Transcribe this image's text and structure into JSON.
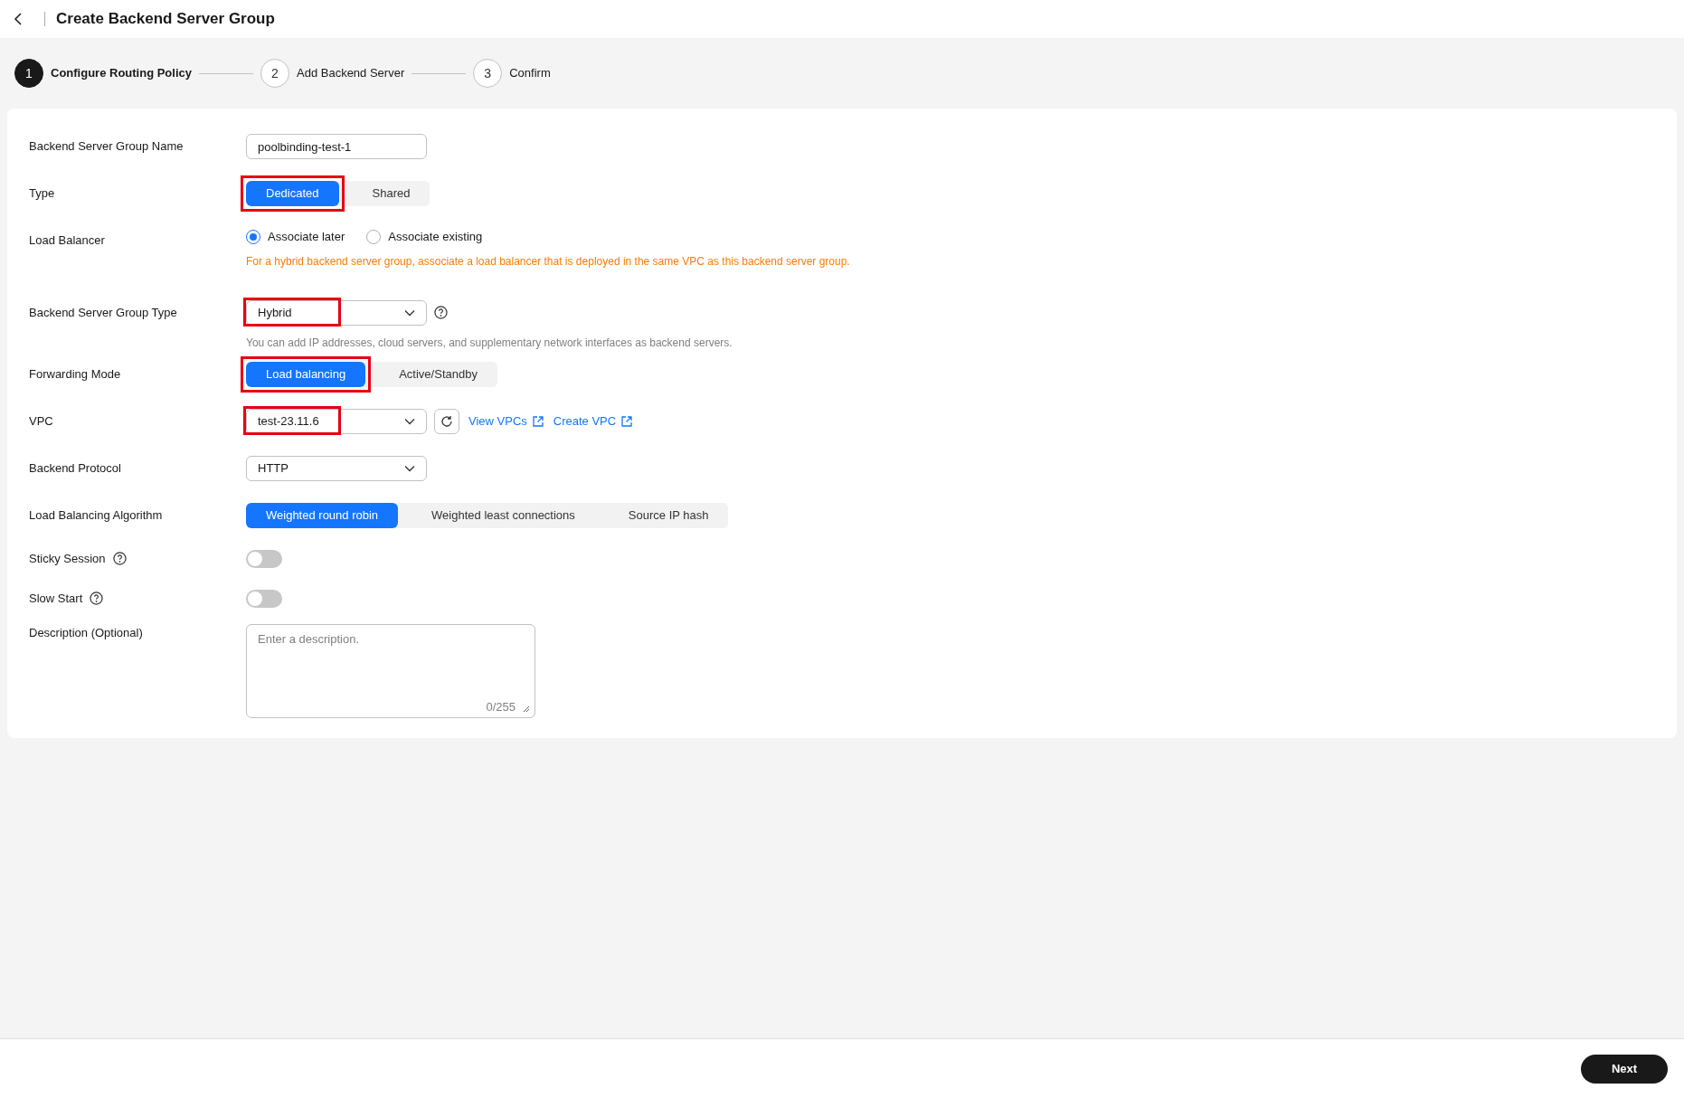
{
  "header": {
    "title": "Create Backend Server Group"
  },
  "steps": [
    {
      "number": "1",
      "label": "Configure Routing Policy",
      "selected": true
    },
    {
      "number": "2",
      "label": "Add Backend Server",
      "selected": false
    },
    {
      "number": "3",
      "label": "Confirm",
      "selected": false
    }
  ],
  "fields": [
    {
      "kind": "text",
      "label": "Backend Server Group Name",
      "help": false,
      "value": "poolbinding-test-1"
    },
    {
      "kind": "segmented",
      "label": "Type",
      "help": false,
      "options": [
        {
          "label": "Dedicated",
          "selected": true,
          "highlighted": true
        },
        {
          "label": "Shared",
          "selected": false,
          "highlighted": false
        }
      ]
    },
    {
      "kind": "radio",
      "label": "Load Balancer",
      "help": false,
      "options": [
        {
          "label": "Associate later",
          "selected": true
        },
        {
          "label": "Associate existing",
          "selected": false
        }
      ],
      "note": {
        "kind": "warning",
        "text": "For a hybrid backend server group, associate a load balancer that is deployed in the same VPC as this backend server group."
      }
    },
    {
      "kind": "select",
      "label": "Backend Server Group Type",
      "help": false,
      "value": "Hybrid",
      "highlighted": true,
      "help_after": true,
      "note": {
        "kind": "info",
        "text": "You can add IP addresses, cloud servers, and supplementary network interfaces as backend servers."
      }
    },
    {
      "kind": "segmented",
      "label": "Forwarding Mode",
      "help": false,
      "options": [
        {
          "label": "Load balancing",
          "selected": true,
          "highlighted": true
        },
        {
          "label": "Active/Standby",
          "selected": false,
          "highlighted": false
        }
      ]
    },
    {
      "kind": "select",
      "label": "VPC",
      "help": false,
      "value": "test-23.11.6",
      "highlighted": true,
      "help_after": false,
      "refresh": true,
      "links": [
        "View VPCs",
        "Create VPC"
      ]
    },
    {
      "kind": "select",
      "label": "Backend Protocol",
      "help": false,
      "value": "HTTP",
      "highlighted": false,
      "help_after": false
    },
    {
      "kind": "segmented",
      "label": "Load Balancing Algorithm",
      "help": false,
      "options": [
        {
          "label": "Weighted round robin",
          "selected": true,
          "highlighted": false
        },
        {
          "label": "Weighted least connections",
          "selected": false,
          "highlighted": false
        },
        {
          "label": "Source IP hash",
          "selected": false,
          "highlighted": false
        }
      ]
    },
    {
      "kind": "toggle",
      "label": "Sticky Session",
      "help": true,
      "on": false
    },
    {
      "kind": "toggle",
      "label": "Slow Start",
      "help": true,
      "on": false
    },
    {
      "kind": "textarea",
      "label": "Description (Optional)",
      "help": false,
      "placeholder": "Enter a description.",
      "counter": "0/255"
    }
  ],
  "footer": {
    "next": "Next"
  }
}
